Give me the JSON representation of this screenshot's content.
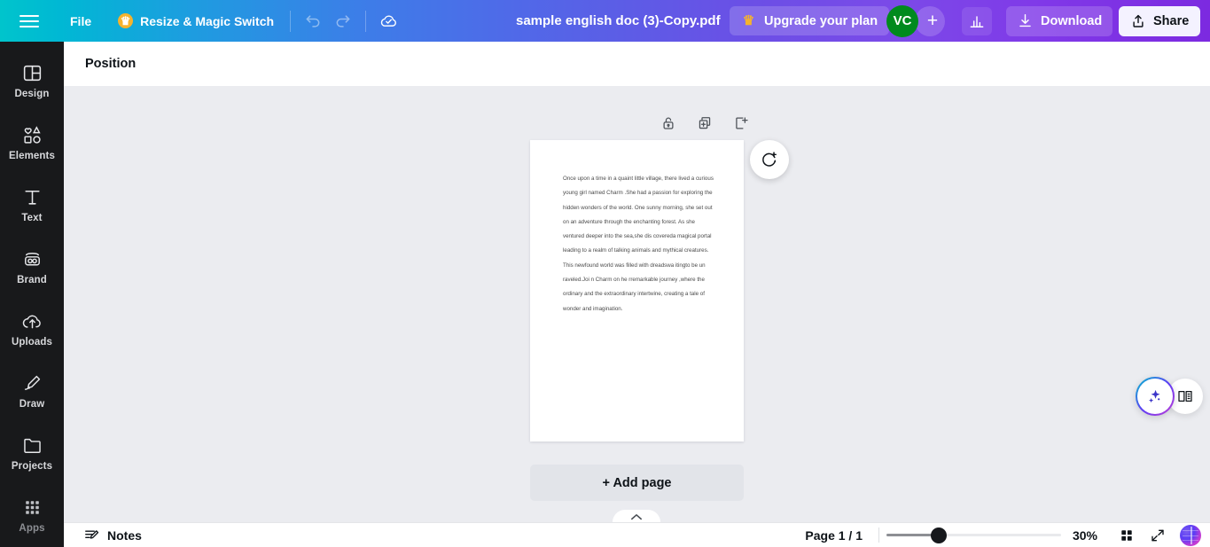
{
  "header": {
    "menu_icon": "hamburger-menu-icon",
    "file_label": "File",
    "resize_label": "Resize & Magic Switch",
    "crown_icon": "crown-icon",
    "undo_icon": "undo-icon",
    "redo_icon": "redo-icon",
    "cloud_saved_icon": "cloud-check-icon",
    "doc_title": "sample english doc (3)-Copy.pdf",
    "upgrade_label": "Upgrade your plan",
    "avatar_initials": "VC",
    "add_collaborator_label": "+",
    "stats_icon": "bar-chart-icon",
    "download_label": "Download",
    "download_icon": "download-icon",
    "share_label": "Share",
    "share_icon": "share-upload-icon",
    "gradient_start": "#00c4cc",
    "gradient_end": "#7c2ae0",
    "avatar_color": "#008a1e"
  },
  "sidebar": {
    "items": [
      {
        "label": "Design",
        "icon": "design-panels-icon"
      },
      {
        "label": "Elements",
        "icon": "elements-shapes-icon"
      },
      {
        "label": "Text",
        "icon": "text-t-icon"
      },
      {
        "label": "Brand",
        "icon": "brand-icon"
      },
      {
        "label": "Uploads",
        "icon": "uploads-cloud-icon"
      },
      {
        "label": "Draw",
        "icon": "draw-pen-icon"
      },
      {
        "label": "Projects",
        "icon": "projects-folder-icon"
      },
      {
        "label": "Apps",
        "icon": "apps-grid-icon"
      }
    ],
    "background": "#18191b"
  },
  "toolbar": {
    "position_label": "Position"
  },
  "canvas": {
    "background": "#ebecf0",
    "page_tools": [
      {
        "name": "lock-page",
        "icon": "lock-icon"
      },
      {
        "name": "duplicate-page",
        "icon": "duplicate-plus-icon"
      },
      {
        "name": "add-page-after",
        "icon": "add-page-icon"
      }
    ],
    "comment_fab_icon": "add-comment-icon",
    "add_page_label": "+ Add page",
    "collapse_icon": "chevron-up-icon",
    "document_text": "Once upon a time in a quaint little village, there lived a curious young girl named Charm .She had a passion for exploring the hidden wonders of the world. One sunny morning, she set out on an adventure through the enchanting forest. As she ventured deeper into the sea,she dis covereda magical portal leading to a realm of talking animals and mythical creatures. This newfound world was filled with dreadswa itingto be un raveled.Joi n Charm on he rremarkable journey ,where the ordinary and the extraordinary intertwine, creating a tale of wonder and imagination."
  },
  "floating": {
    "magic_icon": "magic-sparkle-icon",
    "docs_icon": "open-book-icon"
  },
  "bottom": {
    "notes_label": "Notes",
    "notes_icon": "notes-edit-icon",
    "page_indicator": "Page 1 / 1",
    "zoom_value": "30%",
    "zoom_percent": 30,
    "grid_icon": "grid-view-icon",
    "fullscreen_icon": "expand-arrows-icon",
    "assistant_icon": "ai-brain-icon"
  }
}
